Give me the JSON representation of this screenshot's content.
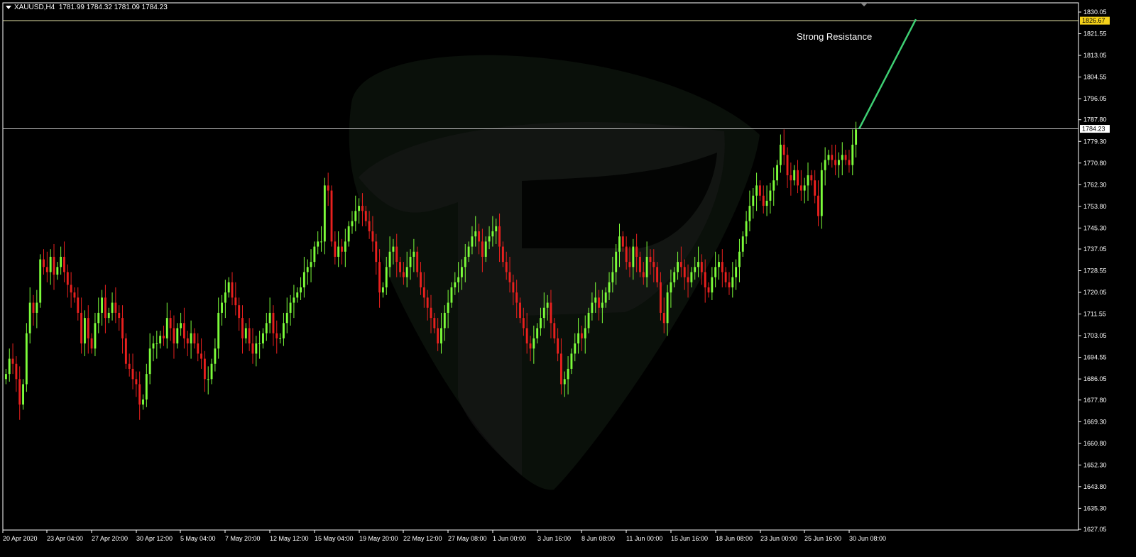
{
  "header": {
    "symbol": "XAUUSD,H4",
    "open": "1781.99",
    "high": "1784.32",
    "low": "1781.09",
    "close": "1784.23"
  },
  "colors": {
    "background": "#000000",
    "axis": "#ffffff",
    "bull_candle": "#7cfc3a",
    "bear_candle": "#e8201e",
    "resistance_line": "#f2f0b0",
    "current_line": "#c8c8c8",
    "trend_arrow": "#3ecf73",
    "resistance_tag_bg": "#f5d21a",
    "current_tag_bg": "#ffffff",
    "watermark": "#1a1a1a"
  },
  "chart_data": {
    "type": "candlestick",
    "title": "",
    "ylim": [
      1627.05,
      1830.05
    ],
    "y_tick_labels": [
      "1830.05",
      "1821.55",
      "1813.05",
      "1804.55",
      "1796.05",
      "1787.80",
      "1779.30",
      "1770.80",
      "1762.30",
      "1753.80",
      "1745.30",
      "1737.05",
      "1728.55",
      "1720.05",
      "1711.55",
      "1703.05",
      "1694.55",
      "1686.05",
      "1677.80",
      "1669.30",
      "1660.80",
      "1652.30",
      "1643.80",
      "1635.30",
      "1627.05"
    ],
    "x_tick_labels": [
      "20 Apr 2020",
      "23 Apr 04:00",
      "27 Apr 20:00",
      "30 Apr 12:00",
      "5 May 04:00",
      "7 May 20:00",
      "12 May 12:00",
      "15 May 04:00",
      "19 May 20:00",
      "22 May 12:00",
      "27 May 08:00",
      "1 Jun 00:00",
      "3 Jun 16:00",
      "8 Jun 08:00",
      "11 Jun 00:00",
      "15 Jun 16:00",
      "18 Jun 08:00",
      "23 Jun 00:00",
      "25 Jun 16:00",
      "30 Jun 08:00"
    ],
    "resistance_level": 1826.67,
    "resistance_label": "1826.67",
    "current_price": 1784.23,
    "current_label": "1784.23",
    "annotation": "Strong Resistance",
    "trend_arrow": {
      "from_price": 1784.23,
      "to_price": 1826.67
    },
    "closes": [
      1688,
      1694,
      1692,
      1686,
      1676,
      1684,
      1704,
      1716,
      1712,
      1716,
      1733,
      1730,
      1728,
      1734,
      1727,
      1730,
      1734,
      1728,
      1723,
      1720,
      1718,
      1712,
      1700,
      1710,
      1702,
      1698,
      1708,
      1712,
      1718,
      1710,
      1712,
      1716,
      1712,
      1710,
      1702,
      1692,
      1690,
      1686,
      1684,
      1676,
      1678,
      1688,
      1698,
      1700,
      1700,
      1703,
      1702,
      1710,
      1706,
      1700,
      1706,
      1708,
      1702,
      1700,
      1704,
      1700,
      1696,
      1694,
      1686,
      1686,
      1692,
      1698,
      1712,
      1716,
      1720,
      1724,
      1718,
      1715,
      1710,
      1702,
      1706,
      1700,
      1696,
      1700,
      1700,
      1704,
      1708,
      1712,
      1704,
      1702,
      1702,
      1708,
      1712,
      1716,
      1718,
      1720,
      1722,
      1728,
      1730,
      1732,
      1738,
      1740,
      1740,
      1762,
      1760,
      1740,
      1734,
      1738,
      1736,
      1740,
      1746,
      1748,
      1752,
      1754,
      1752,
      1748,
      1744,
      1740,
      1732,
      1720,
      1722,
      1730,
      1736,
      1738,
      1732,
      1728,
      1726,
      1730,
      1734,
      1736,
      1728,
      1722,
      1718,
      1714,
      1710,
      1706,
      1700,
      1706,
      1712,
      1716,
      1722,
      1724,
      1726,
      1730,
      1734,
      1738,
      1742,
      1744,
      1740,
      1734,
      1740,
      1742,
      1744,
      1746,
      1738,
      1732,
      1728,
      1724,
      1720,
      1716,
      1710,
      1706,
      1700,
      1698,
      1702,
      1706,
      1710,
      1714,
      1716,
      1708,
      1702,
      1696,
      1684,
      1686,
      1690,
      1696,
      1700,
      1704,
      1702,
      1706,
      1712,
      1716,
      1718,
      1714,
      1716,
      1720,
      1724,
      1728,
      1736,
      1742,
      1738,
      1732,
      1730,
      1738,
      1734,
      1728,
      1726,
      1734,
      1732,
      1730,
      1724,
      1712,
      1708,
      1720,
      1724,
      1728,
      1732,
      1730,
      1726,
      1724,
      1728,
      1730,
      1732,
      1728,
      1722,
      1720,
      1726,
      1730,
      1732,
      1728,
      1724,
      1722,
      1726,
      1730,
      1736,
      1742,
      1748,
      1754,
      1758,
      1762,
      1758,
      1754,
      1756,
      1760,
      1764,
      1770,
      1778,
      1774,
      1766,
      1764,
      1768,
      1762,
      1760,
      1762,
      1766,
      1764,
      1758,
      1750,
      1768,
      1772,
      1774,
      1772,
      1770,
      1772,
      1774,
      1772,
      1770,
      1778,
      1784
    ]
  }
}
